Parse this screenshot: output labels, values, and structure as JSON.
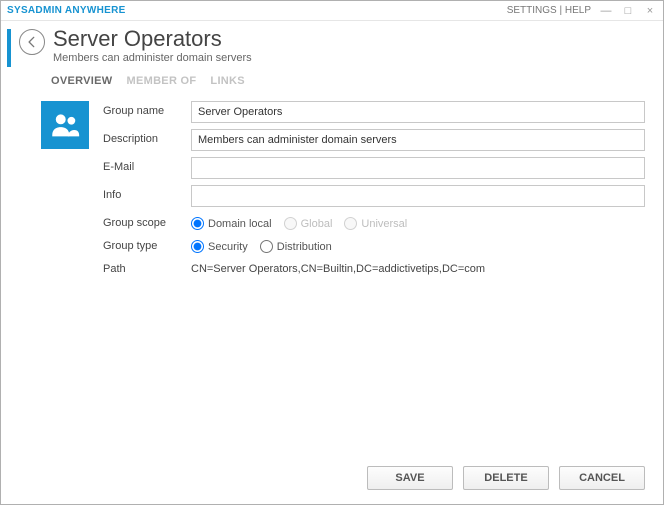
{
  "app": {
    "brand": "SYSADMIN ANYWHERE",
    "links": {
      "settings": "SETTINGS",
      "sep": "|",
      "help": "HELP"
    }
  },
  "header": {
    "title": "Server Operators",
    "subtitle": "Members can administer domain servers"
  },
  "tabs": {
    "overview": "OVERVIEW",
    "memberof": "MEMBER OF",
    "links": "LINKS"
  },
  "form": {
    "group_name": {
      "label": "Group name",
      "value": "Server Operators"
    },
    "description": {
      "label": "Description",
      "value": "Members can administer domain servers"
    },
    "email": {
      "label": "E-Mail",
      "value": ""
    },
    "info": {
      "label": "Info",
      "value": ""
    },
    "group_scope": {
      "label": "Group scope",
      "options": {
        "domain_local": "Domain local",
        "global": "Global",
        "universal": "Universal"
      }
    },
    "group_type": {
      "label": "Group type",
      "options": {
        "security": "Security",
        "distribution": "Distribution"
      }
    },
    "path": {
      "label": "Path",
      "value": "CN=Server Operators,CN=Builtin,DC=addictivetips,DC=com"
    }
  },
  "footer": {
    "save": "SAVE",
    "delete": "DELETE",
    "cancel": "CANCEL"
  }
}
